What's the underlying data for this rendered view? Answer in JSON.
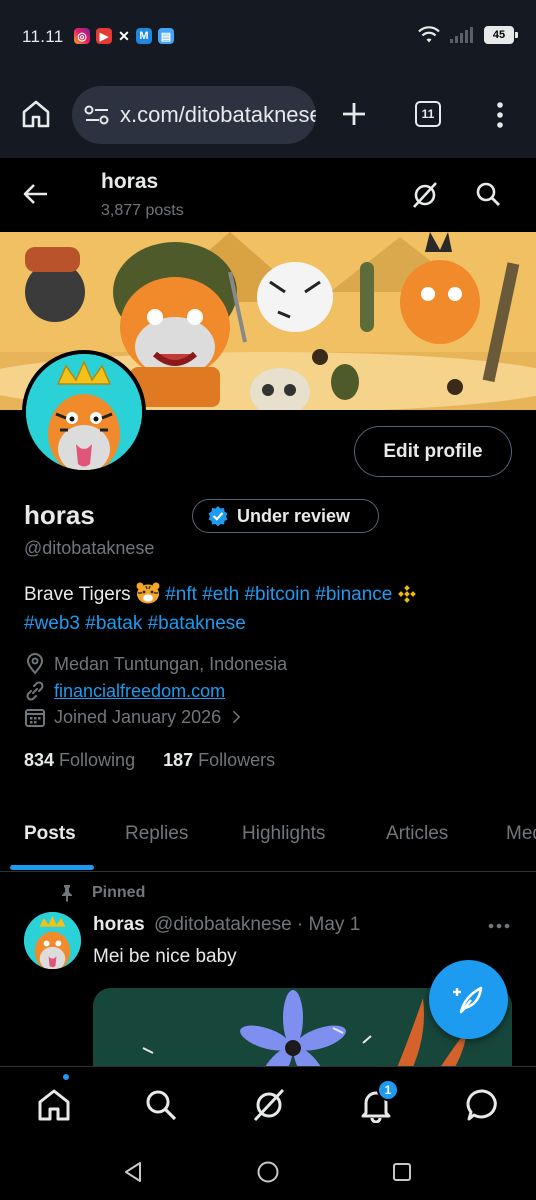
{
  "status_bar": {
    "time": "11.11",
    "battery": "45",
    "notification_icons": [
      "instagram-icon",
      "youtube-icon",
      "x-icon",
      "gmail-icon",
      "notes-icon"
    ]
  },
  "browser": {
    "url": "x.com/ditobataknese",
    "tab_count": "11"
  },
  "header": {
    "name": "horas",
    "post_count": "3,877 posts"
  },
  "profile": {
    "edit_label": "Edit profile",
    "display_name": "horas",
    "badge_label": "Under review",
    "handle": "@ditobataknese",
    "bio": {
      "text": "Brave Tigers",
      "tags_line1": [
        "#nft",
        "#eth",
        "#bitcoin",
        "#binance"
      ],
      "tags_line2": [
        "#web3",
        "#batak",
        "#bataknese"
      ]
    },
    "location": "Medan Tuntungan, Indonesia",
    "website": "financialfreedom.com",
    "joined": "Joined January 2026",
    "following_count": "834",
    "following_label": "Following",
    "followers_count": "187",
    "followers_label": "Followers"
  },
  "tabs": [
    "Posts",
    "Replies",
    "Highlights",
    "Articles",
    "Media"
  ],
  "post": {
    "pinned_label": "Pinned",
    "author_name": "horas",
    "author_handle": "@ditobataknese",
    "separator": "·",
    "date": "May 1",
    "text": "Mei be nice baby"
  },
  "bottom_nav": {
    "items": [
      "home-icon",
      "search-icon",
      "grok-icon",
      "notifications-icon",
      "messages-icon"
    ],
    "notification_count": "1"
  },
  "colors": {
    "accent": "#1d9bf0",
    "background": "#000000",
    "muted_text": "#71767b",
    "browser_chrome": "#151a22"
  }
}
